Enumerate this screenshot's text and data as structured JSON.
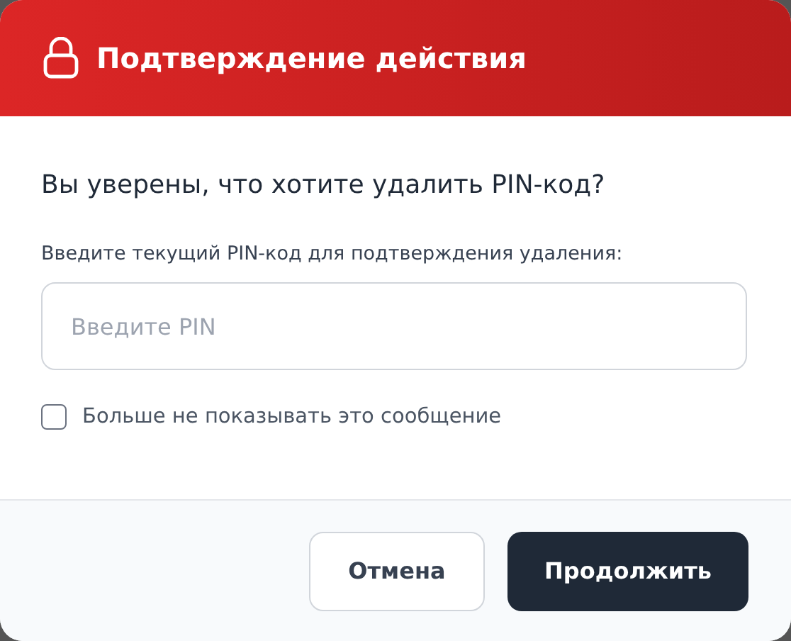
{
  "dialog": {
    "title": "Подтверждение действия",
    "question": "Вы уверены, что хотите удалить PIN-код?",
    "field_label": "Введите текущий PIN-код для подтверждения удаления:",
    "pin_field": {
      "placeholder": "Введите PIN"
    },
    "dont_show": {
      "label": "Больше не показывать это сообщение",
      "checked": false
    },
    "buttons": [
      {
        "label": "Отмена",
        "kind": "secondary"
      },
      {
        "label": "Продолжить",
        "kind": "primary"
      }
    ]
  }
}
